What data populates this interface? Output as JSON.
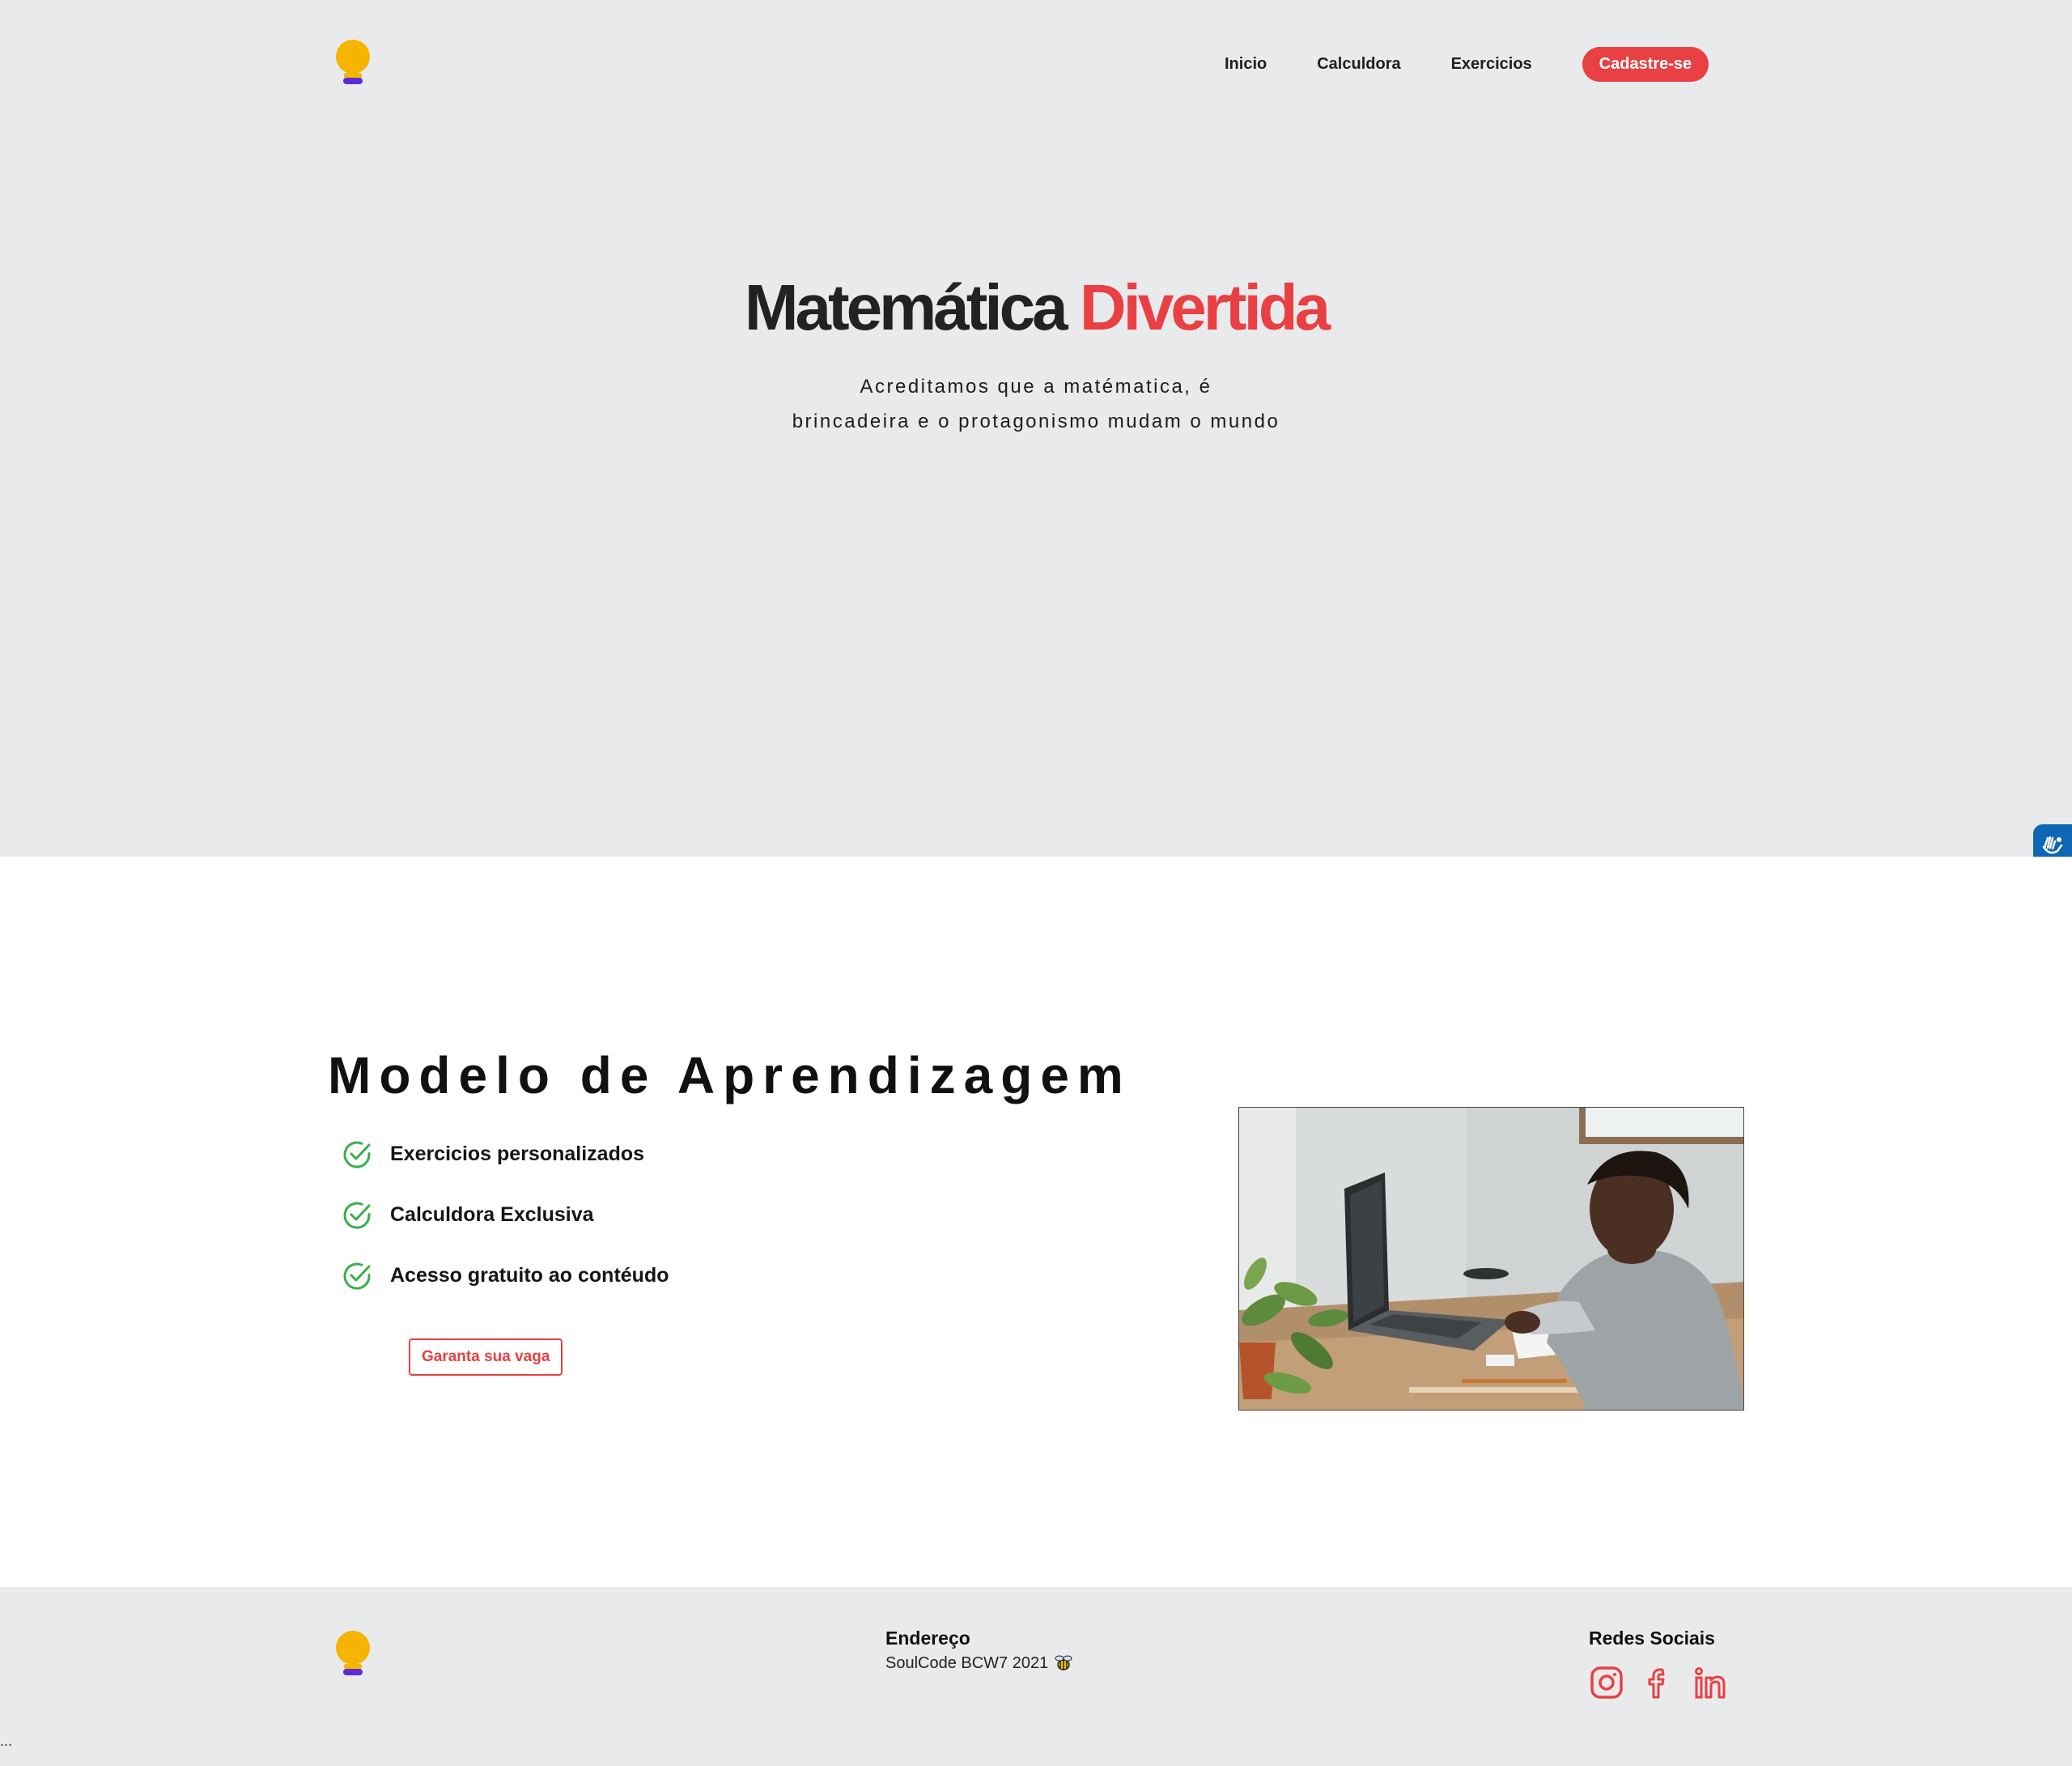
{
  "header": {
    "nav": [
      {
        "label": "Inicio"
      },
      {
        "label": "Calculdora"
      },
      {
        "label": "Exercicios"
      }
    ],
    "cta_label": "Cadastre-se"
  },
  "hero": {
    "title_main": "Matemática",
    "title_accent": "Divertida",
    "subtitle_line1": "Acreditamos que a matématica, é",
    "subtitle_line2": "brincadeira e o protagonismo mudam o mundo"
  },
  "learning": {
    "title": "Modelo de Aprendizagem",
    "features": [
      {
        "label": "Exercicios personalizados",
        "icon": "check-circle-icon"
      },
      {
        "label": "Calculdora Exclusiva",
        "icon": "check-circle-icon"
      },
      {
        "label": "Acesso gratuito ao contéudo",
        "icon": "check-circle-icon"
      }
    ],
    "button_label": "Garanta sua vaga"
  },
  "footer": {
    "address_title": "Endereço",
    "address_text": "SoulCode BCW7 2021",
    "social_title": "Redes Sociais",
    "social": [
      "instagram-icon",
      "facebook-icon",
      "linkedin-icon"
    ]
  },
  "trailing_text": "...",
  "colors": {
    "accent": "#e84043",
    "hero_bg": "#e9eaec",
    "logo_yellow": "#f5b400",
    "logo_purple": "#5b2bd6",
    "check_green": "#3aae4a",
    "a11y_blue": "#0d67b5"
  }
}
